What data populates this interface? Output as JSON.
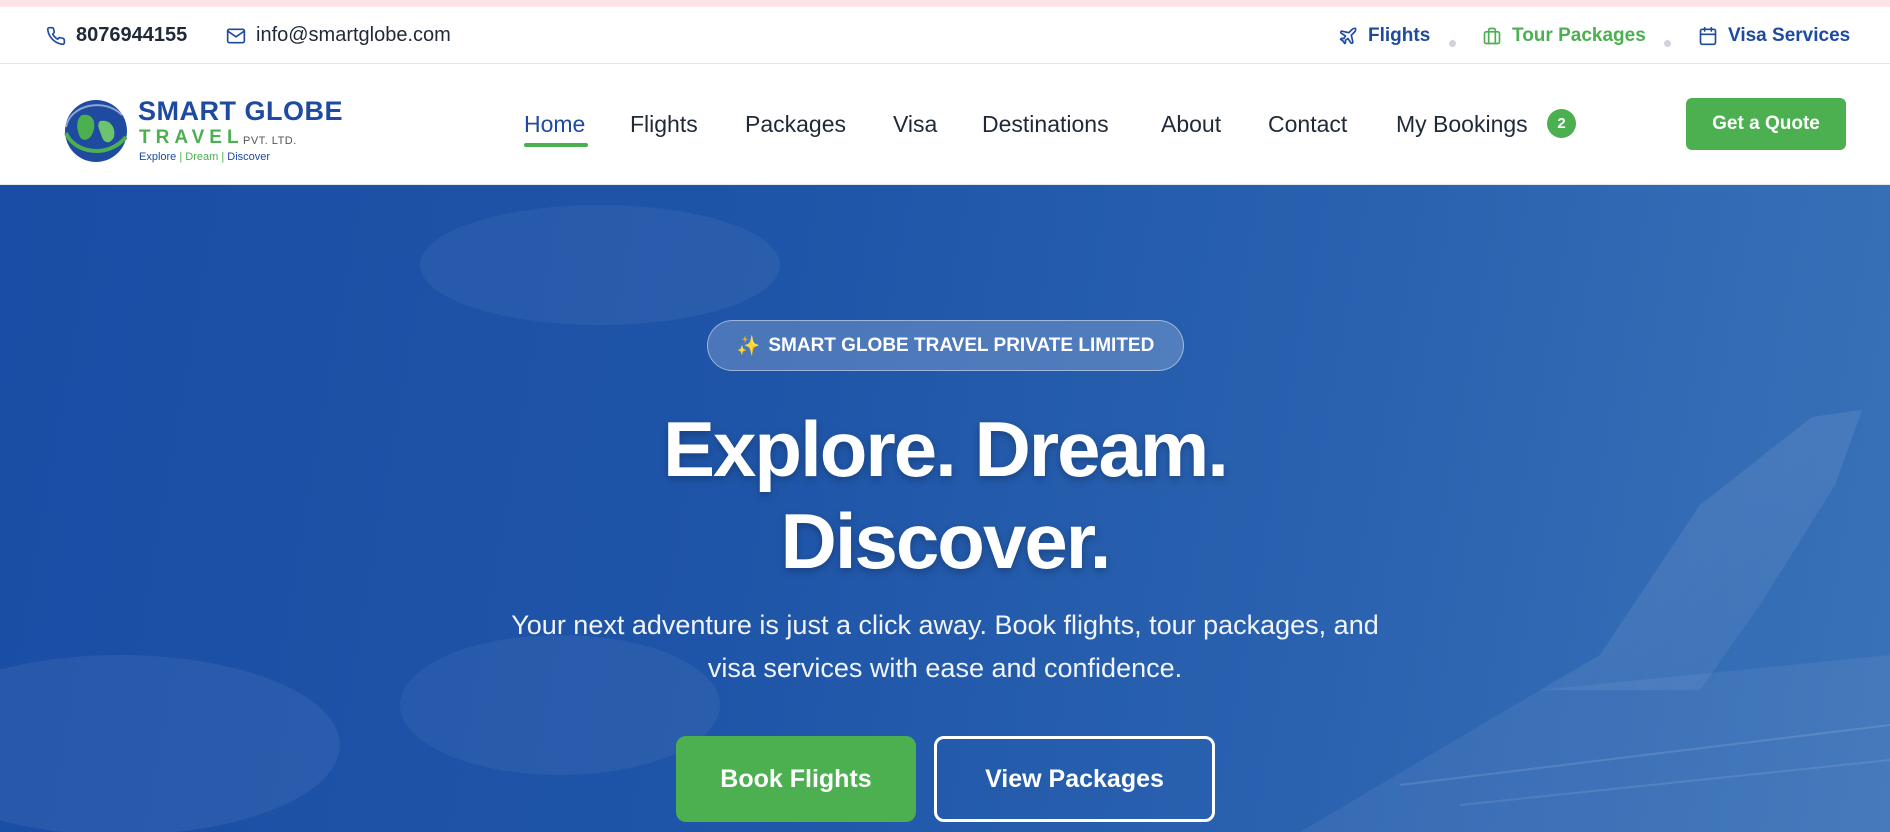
{
  "topbar": {
    "phone": "8076944155",
    "email": "info@smartglobe.com",
    "links": [
      {
        "label": "Flights",
        "icon": "plane-icon"
      },
      {
        "label": "Tour Packages",
        "icon": "briefcase-icon"
      },
      {
        "label": "Visa Services",
        "icon": "calendar-icon"
      }
    ]
  },
  "logo": {
    "brand": "SMART GLOBE",
    "sub": "TRAVEL",
    "pvt": "PVT. LTD.",
    "tag_explore": "Explore",
    "tag_dream": "Dream",
    "tag_discover": "Discover",
    "tag_sep": "|"
  },
  "nav": {
    "items": [
      "Home",
      "Flights",
      "Packages",
      "Visa",
      "Destinations",
      "About",
      "Contact",
      "My Bookings"
    ],
    "active": "Home",
    "bookings_count": "2",
    "cta": "Get a Quote"
  },
  "hero": {
    "badge_icon": "✨",
    "badge": "SMART GLOBE TRAVEL PRIVATE LIMITED",
    "title_line1": "Explore. Dream.",
    "title_line2": "Discover.",
    "subtitle_line1": "Your next adventure is just a click away. Book flights, tour packages, and",
    "subtitle_line2": "visa services with ease and confidence.",
    "btn_primary": "Book Flights",
    "btn_secondary": "View Packages"
  },
  "colors": {
    "brand_blue": "#1e4aa0",
    "brand_green": "#4caf50",
    "hero_blue": "#1f55a8"
  }
}
